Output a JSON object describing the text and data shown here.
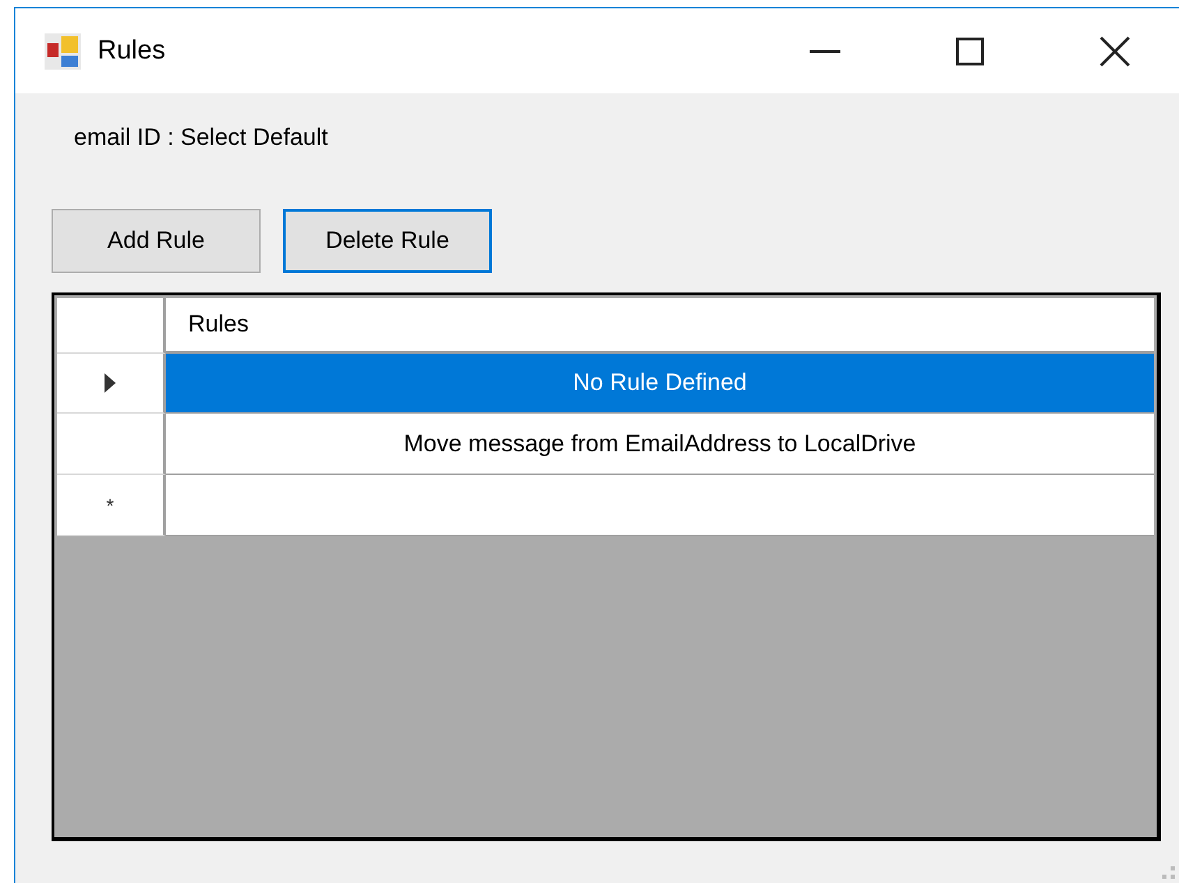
{
  "window": {
    "title": "Rules"
  },
  "email_label": "email ID : Select Default",
  "buttons": [
    {
      "label": "Add Rule",
      "focused": false
    },
    {
      "label": "Delete Rule",
      "focused": true
    }
  ],
  "table": {
    "columns": [
      "Rules"
    ],
    "rows": [
      {
        "kind": "data",
        "selected": true,
        "cell": "No Rule Defined"
      },
      {
        "kind": "data",
        "selected": false,
        "cell": "Move message from EmailAddress to LocalDrive"
      },
      {
        "kind": "new",
        "selected": false,
        "marker": "*"
      }
    ]
  }
}
